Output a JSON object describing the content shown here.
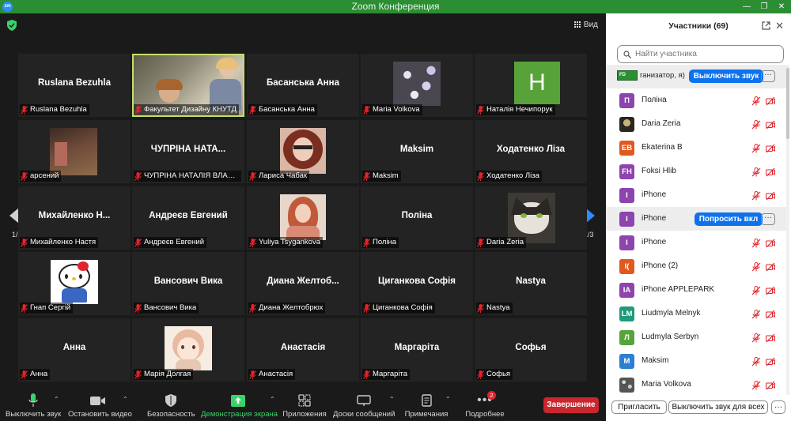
{
  "window": {
    "title": "Zoom Конференция",
    "app_icon": "zm"
  },
  "view": {
    "label": "Вид"
  },
  "paging": {
    "left": "1/3",
    "right": "1/3"
  },
  "tiles": [
    {
      "big": "Ruslana Bezuhla",
      "label": "Ruslana Bezuhla"
    },
    {
      "big": "",
      "label": "Факультет Дизайну КНУТД"
    },
    {
      "big": "Басанська Анна",
      "label": "Басанська Анна"
    },
    {
      "big": "",
      "label": "Maria Volkova"
    },
    {
      "big": "",
      "label": "Наталія Нечипорук",
      "avatar": "Н"
    },
    {
      "big": "",
      "label": "арсений"
    },
    {
      "big": "ЧУПРІНА НАТА...",
      "label": "ЧУПРІНА НАТАЛІЯ ВЛАДИ..."
    },
    {
      "big": "",
      "label": "Лариса Чабак"
    },
    {
      "big": "Maksim",
      "label": "Maksim"
    },
    {
      "big": "Ходатенко Ліза",
      "label": "Ходатенко Ліза"
    },
    {
      "big": "Михайленко Н...",
      "label": "Михайленко Настя"
    },
    {
      "big": "Андреєв Евгений",
      "label": "Андреєв Евгений"
    },
    {
      "big": "",
      "label": "Yuliya Tsygankova"
    },
    {
      "big": "Поліна",
      "label": "Поліна"
    },
    {
      "big": "",
      "label": "Daria Zeria"
    },
    {
      "big": "",
      "label": "Гнап Сергій"
    },
    {
      "big": "Вансович Вика",
      "label": "Вансович Вика"
    },
    {
      "big": "Диана Желтоб...",
      "label": "Диана Желтобрюх"
    },
    {
      "big": "Циганкова Софія",
      "label": "Циганкова Софія"
    },
    {
      "big": "Nastya",
      "label": "Nastya"
    },
    {
      "big": "Анна",
      "label": "Анна"
    },
    {
      "big": "",
      "label": "Марія Долгая"
    },
    {
      "big": "Анастасія",
      "label": "Анастасія"
    },
    {
      "big": "Маргаріта",
      "label": "Маргаріта"
    },
    {
      "big": "Софья",
      "label": "Софья"
    }
  ],
  "toolbar": {
    "mute": "Выключить звук",
    "video": "Остановить видео",
    "security": "Безопасность",
    "share": "Демонстрация экрана",
    "apps": "Приложения",
    "whiteboard": "Доски сообщений",
    "notes": "Примечания",
    "more": "Подробнее",
    "more_badge": "2",
    "end": "Завершение"
  },
  "panel": {
    "title": "Участники (69)",
    "search_placeholder": "Найти участника",
    "host_row": {
      "name": "ганизатор, я)",
      "action": "Выключить звук",
      "more": "···"
    },
    "ask_action": "Попросить вкл",
    "ask_more": "···",
    "participants": [
      {
        "initials": "П",
        "name": "Поліна",
        "color": "#8e44ad"
      },
      {
        "initials": "",
        "name": "Daria Zeria",
        "color": "#333333",
        "photo": true
      },
      {
        "initials": "EB",
        "name": "Ekaterina B",
        "color": "#e05a1f"
      },
      {
        "initials": "FH",
        "name": "Foksi Hlib",
        "color": "#8e44ad"
      },
      {
        "initials": "I",
        "name": "iPhone",
        "color": "#8e44ad"
      },
      {
        "initials": "I",
        "name": "iPhone",
        "color": "#8e44ad",
        "highlight": true
      },
      {
        "initials": "I",
        "name": "iPhone",
        "color": "#8e44ad"
      },
      {
        "initials": "I(",
        "name": "iPhone (2)",
        "color": "#e05a1f"
      },
      {
        "initials": "IA",
        "name": "iPhone APPLEPARK",
        "color": "#8e44ad"
      },
      {
        "initials": "LM",
        "name": "Liudmyla Melnyk",
        "color": "#1f9b7a"
      },
      {
        "initials": "Л",
        "name": "Ludmyla Serbyn",
        "color": "#57a53a"
      },
      {
        "initials": "M",
        "name": "Maksim",
        "color": "#2d7fd3"
      },
      {
        "initials": "",
        "name": "Maria Volkova",
        "color": "#777777",
        "photo": true
      }
    ],
    "invite": "Пригласить",
    "mute_all": "Выключить звук для всех",
    "footer_more": "···"
  },
  "colors": {
    "accent": "#0e72ed",
    "end": "#c9262d",
    "titlebar": "#2c8e33",
    "muted": "#e0252d"
  }
}
